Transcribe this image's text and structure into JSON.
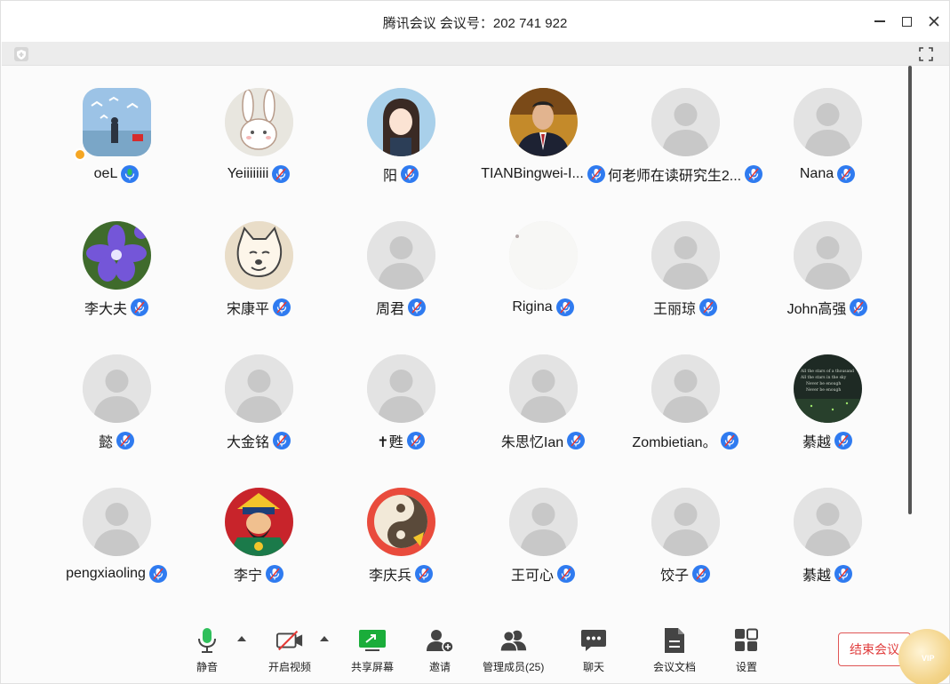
{
  "window": {
    "title": "腾讯会议 会议号：202 741 922"
  },
  "participants": [
    {
      "name": "oeL",
      "avatar": "photo-birds",
      "host": true,
      "mic": "active"
    },
    {
      "name": "Yeiiiiiiii",
      "avatar": "cartoon-rabbit",
      "mic": "muted"
    },
    {
      "name": "阳",
      "avatar": "cartoon-girl",
      "mic": "muted"
    },
    {
      "name": "TIANBingwei-I...",
      "avatar": "photo-man",
      "mic": "muted"
    },
    {
      "name": "何老师在读研究生2...",
      "avatar": "default",
      "mic": "muted"
    },
    {
      "name": "Nana",
      "avatar": "default",
      "mic": "muted"
    },
    {
      "name": "李大夫",
      "avatar": "photo-flower",
      "mic": "muted"
    },
    {
      "name": "宋康平",
      "avatar": "cartoon-cat",
      "mic": "muted"
    },
    {
      "name": "周君",
      "avatar": "default",
      "mic": "muted"
    },
    {
      "name": "Rigina",
      "avatar": "blank-white",
      "mic": "muted"
    },
    {
      "name": "王丽琼",
      "avatar": "default",
      "mic": "muted"
    },
    {
      "name": "John高强",
      "avatar": "default",
      "mic": "muted"
    },
    {
      "name": "懿",
      "avatar": "default",
      "mic": "muted"
    },
    {
      "name": "大金铭",
      "avatar": "default",
      "mic": "muted"
    },
    {
      "name": "✝甦",
      "avatar": "default",
      "mic": "muted"
    },
    {
      "name": "朱思忆Ian",
      "avatar": "default",
      "mic": "muted"
    },
    {
      "name": "Zombietian。",
      "avatar": "default",
      "mic": "muted"
    },
    {
      "name": "綦越",
      "avatar": "dark-forest",
      "mic": "muted"
    },
    {
      "name": "pengxiaoling",
      "avatar": "default",
      "mic": "muted"
    },
    {
      "name": "李宁",
      "avatar": "cartoon-general",
      "mic": "muted"
    },
    {
      "name": "李庆兵",
      "avatar": "photo-yinyang",
      "mic": "muted"
    },
    {
      "name": "王可心",
      "avatar": "default",
      "mic": "muted"
    },
    {
      "name": "饺子",
      "avatar": "default",
      "mic": "muted"
    },
    {
      "name": "綦越",
      "avatar": "default",
      "mic": "muted"
    }
  ],
  "toolbar": {
    "mute": "静音",
    "video": "开启视频",
    "share": "共享屏幕",
    "invite": "邀请",
    "members": "管理成员(25)",
    "chat": "聊天",
    "docs": "会议文档",
    "settings": "设置",
    "end": "结束会议",
    "vip": "VIP"
  },
  "colors": {
    "accent": "#2f7bf0",
    "share_green": "#1aad3a",
    "end_red": "#e03c3c",
    "mic_active": "#2fbf5b"
  }
}
